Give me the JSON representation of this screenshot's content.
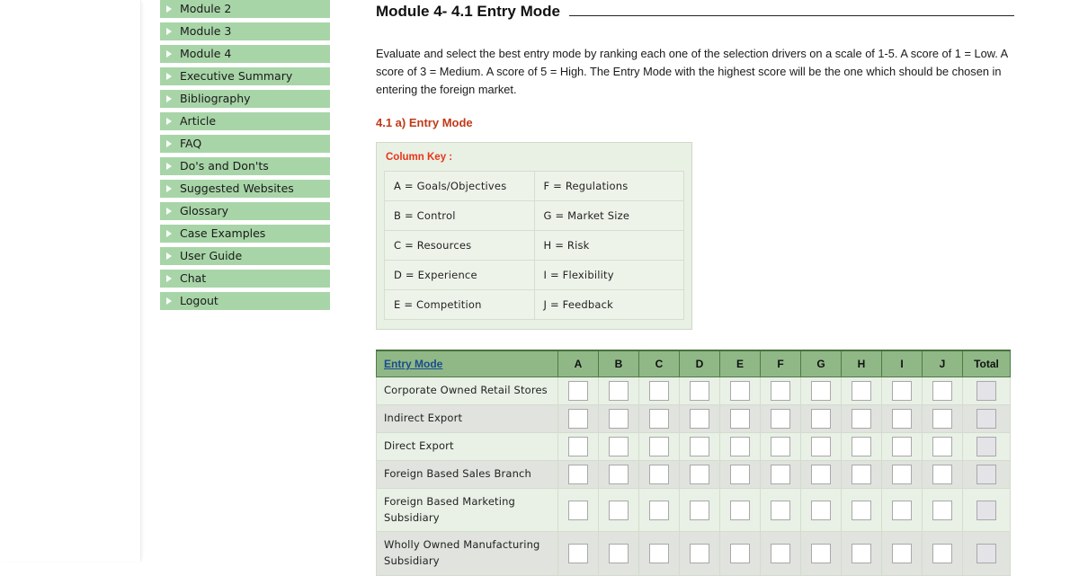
{
  "sidebar": {
    "items": [
      {
        "label": "Module 2",
        "icon": "triangle-right-icon"
      },
      {
        "label": "Module 3",
        "icon": "triangle-right-icon"
      },
      {
        "label": "Module 4",
        "icon": "triangle-right-icon"
      },
      {
        "label": "Executive Summary",
        "icon": "triangle-right-icon"
      },
      {
        "label": "Bibliography",
        "icon": "triangle-right-icon"
      },
      {
        "label": "Article",
        "icon": "triangle-right-icon"
      },
      {
        "label": "FAQ",
        "icon": "triangle-right-icon"
      },
      {
        "label": "Do's and Don'ts",
        "icon": "triangle-right-icon"
      },
      {
        "label": "Suggested Websites",
        "icon": "triangle-right-icon"
      },
      {
        "label": "Glossary",
        "icon": "triangle-right-icon"
      },
      {
        "label": "Case Examples",
        "icon": "triangle-right-icon"
      },
      {
        "label": "User Guide",
        "icon": "triangle-right-icon"
      },
      {
        "label": "Chat",
        "icon": "triangle-right-icon"
      },
      {
        "label": "Logout",
        "icon": "triangle-right-icon"
      }
    ]
  },
  "main": {
    "heading": "Module 4- 4.1 Entry Mode",
    "intro": "Evaluate and select the best entry mode by ranking each one of the selection drivers on a scale of 1-5. A score of 1 = Low. A score of 3 = Medium. A score of 5 = High. The Entry Mode with the highest score will be the one which should be chosen in entering the foreign market.",
    "section_title": "4.1 a) Entry Mode",
    "column_key": {
      "title": "Column Key :",
      "rows": [
        {
          "left": "A = Goals/Objectives",
          "right": "F = Regulations"
        },
        {
          "left": "B = Control",
          "right": "G = Market Size"
        },
        {
          "left": "C = Resources",
          "right": "H = Risk"
        },
        {
          "left": "D = Experience",
          "right": "I = Flexibility"
        },
        {
          "left": "E = Competition",
          "right": "J = Feedback"
        }
      ]
    },
    "entry_table": {
      "headers": [
        "Entry Mode",
        "A",
        "B",
        "C",
        "D",
        "E",
        "F",
        "G",
        "H",
        "I",
        "J",
        "Total"
      ],
      "mode_header_link": "Entry Mode",
      "score_columns": [
        "A",
        "B",
        "C",
        "D",
        "E",
        "F",
        "G",
        "H",
        "I",
        "J"
      ],
      "total_header": "Total",
      "rows": [
        {
          "mode": "Corporate Owned Retail Stores",
          "scores": [
            "",
            "",
            "",
            "",
            "",
            "",
            "",
            "",
            "",
            ""
          ],
          "total": ""
        },
        {
          "mode": "Indirect Export",
          "scores": [
            "",
            "",
            "",
            "",
            "",
            "",
            "",
            "",
            "",
            ""
          ],
          "total": ""
        },
        {
          "mode": "Direct Export",
          "scores": [
            "",
            "",
            "",
            "",
            "",
            "",
            "",
            "",
            "",
            ""
          ],
          "total": ""
        },
        {
          "mode": "Foreign Based Sales Branch",
          "scores": [
            "",
            "",
            "",
            "",
            "",
            "",
            "",
            "",
            "",
            ""
          ],
          "total": ""
        },
        {
          "mode": "Foreign Based Marketing Subsidiary",
          "scores": [
            "",
            "",
            "",
            "",
            "",
            "",
            "",
            "",
            "",
            ""
          ],
          "total": ""
        },
        {
          "mode": "Wholly Owned Manufacturing Subsidiary",
          "scores": [
            "",
            "",
            "",
            "",
            "",
            "",
            "",
            "",
            "",
            ""
          ],
          "total": ""
        }
      ]
    }
  },
  "colors": {
    "nav_bg": "#a8d5a8",
    "table_header_bg": "#8fb886",
    "row_odd": "#e9f1e6",
    "row_even": "#e0e3de",
    "accent_red": "#c03a17",
    "key_title_red": "#e8341c",
    "link_blue": "#1b4b8f",
    "key_panel_bg": "#e9f0e4"
  }
}
